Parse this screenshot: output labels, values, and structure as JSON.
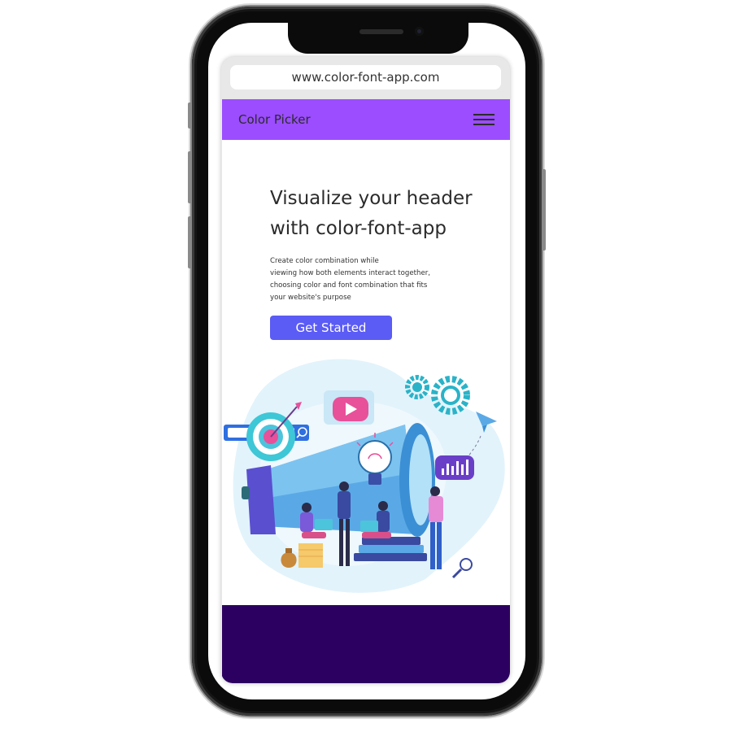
{
  "browser": {
    "url": "www.color-font-app.com"
  },
  "navbar": {
    "brand": "Color Picker",
    "menu_icon": "hamburger-menu-icon"
  },
  "hero": {
    "headline_lines": [
      "Visualize your header",
      "with color-font-app"
    ],
    "description_lines": [
      "Create color combination while",
      "viewing how both elements interact together,",
      "choosing color and font combination that fits",
      "your website's purpose"
    ],
    "cta_label": "Get Started"
  },
  "colors": {
    "navbar": "#9b4dff",
    "button": "#5b5bf5",
    "footer": "#2c0060",
    "text": "#2b2b2b"
  }
}
